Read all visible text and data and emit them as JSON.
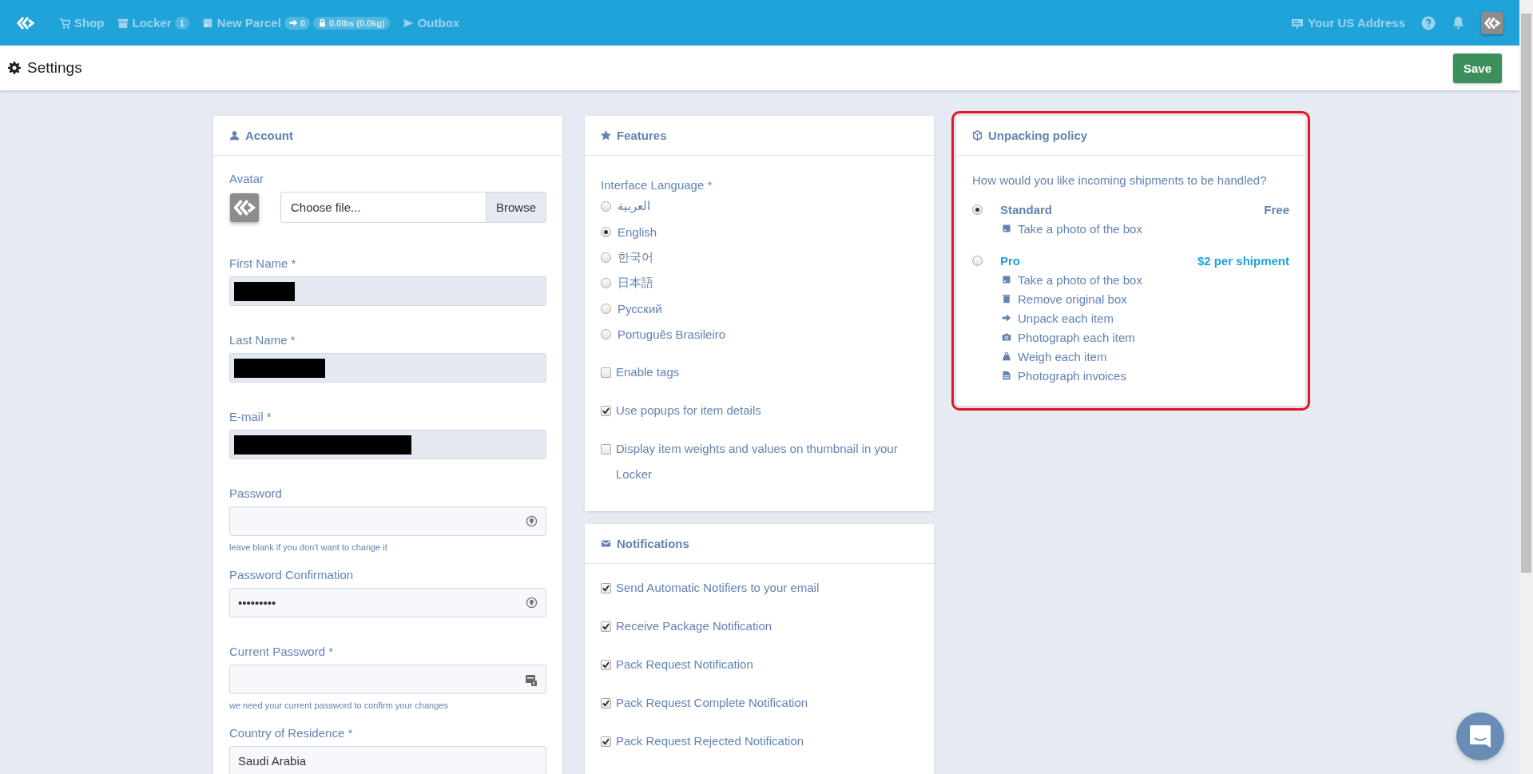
{
  "top_nav": {
    "items": [
      {
        "label": "Shop"
      },
      {
        "label": "Locker",
        "badges": [
          "1"
        ]
      },
      {
        "label": "New Parcel",
        "badges": [
          "0",
          "0.0lbs (0.0kg)"
        ]
      },
      {
        "label": "Outbox"
      }
    ],
    "address_link": "Your US Address"
  },
  "page_header": {
    "title": "Settings",
    "save_button": "Save"
  },
  "account": {
    "title": "Account",
    "avatar_label": "Avatar",
    "file_placeholder": "Choose file...",
    "browse_button": "Browse",
    "fields": [
      {
        "label": "First Name *",
        "kind": "redacted"
      },
      {
        "label": "Last Name *",
        "kind": "redacted"
      },
      {
        "label": "E-mail *",
        "kind": "redacted"
      },
      {
        "label": "Password",
        "kind": "password",
        "hint": "leave blank if you don't want to change it"
      },
      {
        "label": "Password Confirmation",
        "kind": "password",
        "value": "•••••••••"
      },
      {
        "label": "Current Password *",
        "kind": "current",
        "hint": "we need your current password to confirm your changes"
      },
      {
        "label": "Country of Residence *",
        "kind": "select",
        "value": "Saudi Arabia"
      }
    ]
  },
  "features": {
    "title": "Features",
    "language_label": "Interface Language *",
    "languages": [
      {
        "label": "العربية",
        "selected": false
      },
      {
        "label": "English",
        "selected": true
      },
      {
        "label": "한국어",
        "selected": false
      },
      {
        "label": "日本語",
        "selected": false
      },
      {
        "label": "Русский",
        "selected": false
      },
      {
        "label": "Português Brasileiro",
        "selected": false
      }
    ],
    "options": [
      {
        "label": "Enable tags",
        "checked": false
      },
      {
        "label": "Use popups for item details",
        "checked": true
      },
      {
        "label": "Display item weights and values on thumbnail in your Locker",
        "checked": false
      }
    ]
  },
  "notifications": {
    "title": "Notifications",
    "options": [
      {
        "label": "Send Automatic Notifiers to your email",
        "checked": true
      },
      {
        "label": "Receive Package Notification",
        "checked": true
      },
      {
        "label": "Pack Request Notification",
        "checked": true
      },
      {
        "label": "Pack Request Complete Notification",
        "checked": true
      },
      {
        "label": "Pack Request Rejected Notification",
        "checked": true
      }
    ]
  },
  "unpacking": {
    "title": "Unpacking policy",
    "question": "How would you like incoming shipments to be handled?",
    "plans": [
      {
        "name": "Standard",
        "price": "Free",
        "selected": true,
        "steps": [
          "Take a photo of the box"
        ]
      },
      {
        "name": "Pro",
        "price": "$2 per shipment",
        "selected": false,
        "steps": [
          "Take a photo of the box",
          "Remove original box",
          "Unpack each item",
          "Photograph each item",
          "Weigh each item",
          "Photograph invoices"
        ]
      }
    ]
  }
}
